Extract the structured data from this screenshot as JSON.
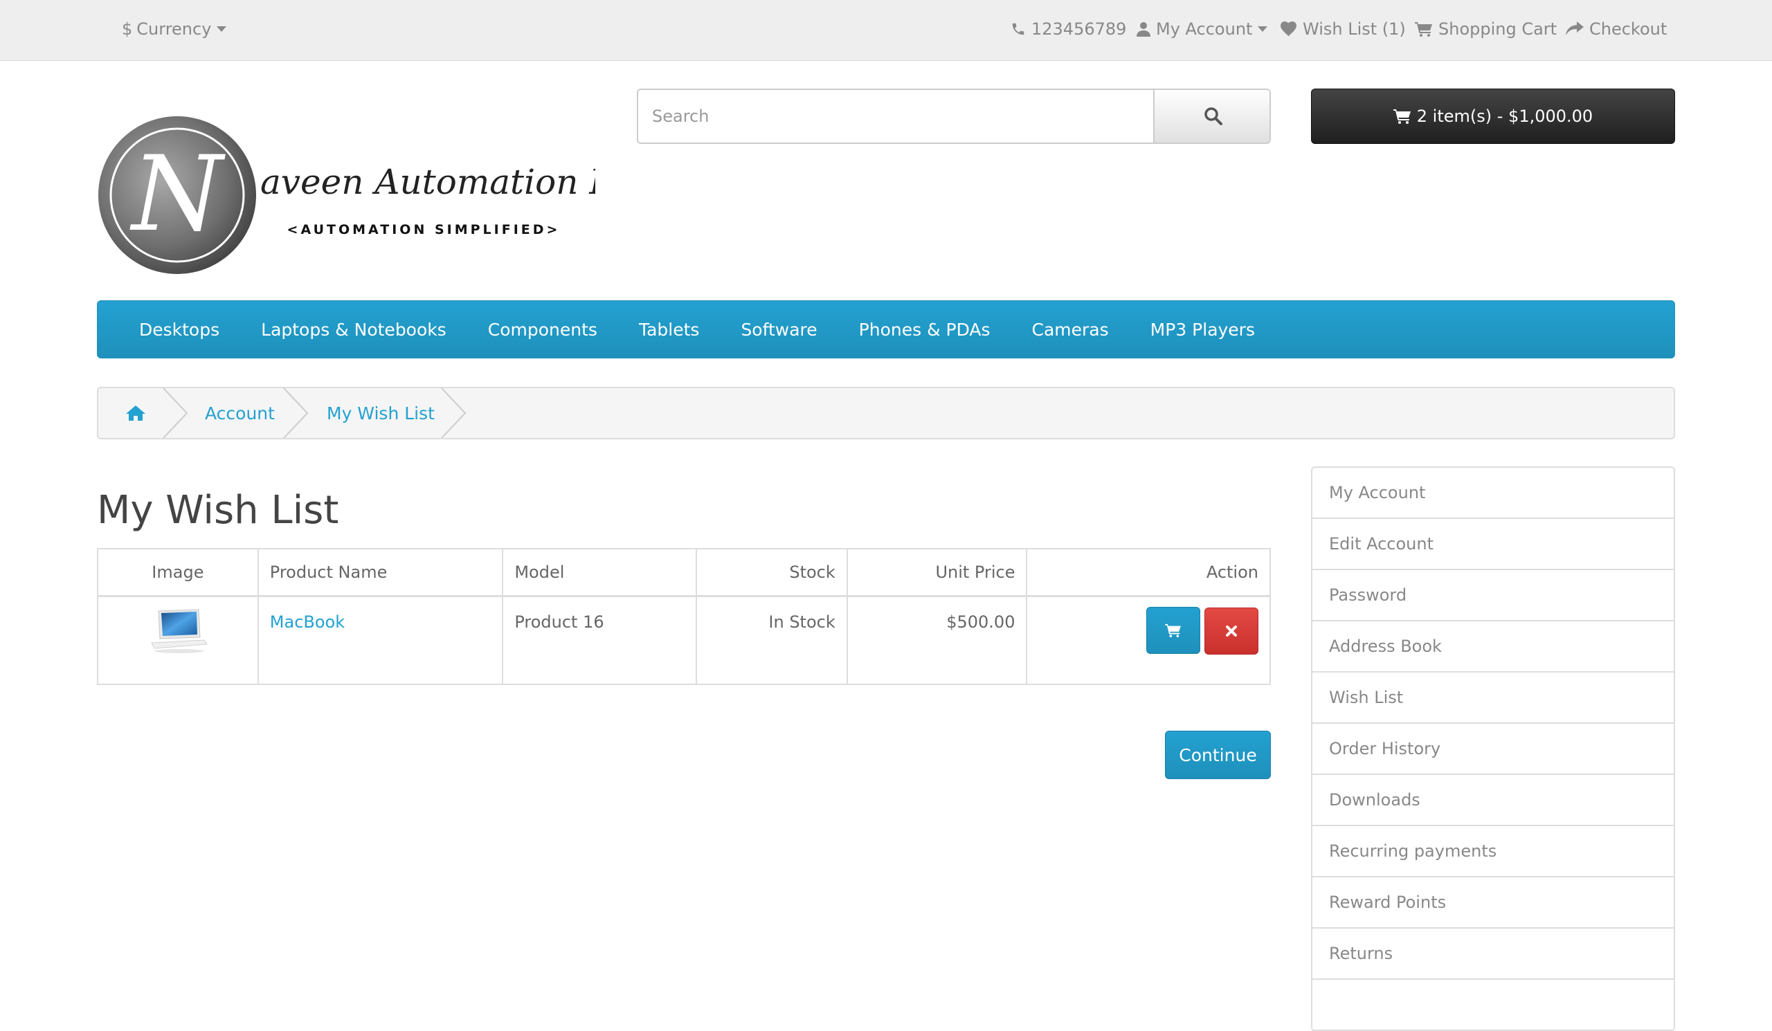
{
  "topbar": {
    "currency_symbol": "$",
    "currency_label": "Currency",
    "phone": "123456789",
    "my_account": "My Account",
    "wish_list": "Wish List (1)",
    "shopping_cart": "Shopping Cart",
    "checkout": "Checkout"
  },
  "header": {
    "logo_letter": "N",
    "logo_text": "aveen Automation Labs",
    "logo_tagline": "<AUTOMATION SIMPLIFIED>",
    "search_placeholder": "Search",
    "cart_summary": "2 item(s) - $1,000.00"
  },
  "menu": [
    "Desktops",
    "Laptops & Notebooks",
    "Components",
    "Tablets",
    "Software",
    "Phones & PDAs",
    "Cameras",
    "MP3 Players"
  ],
  "breadcrumb": [
    "Account",
    "My Wish List"
  ],
  "page_title": "My Wish List",
  "table": {
    "headers": [
      "Image",
      "Product Name",
      "Model",
      "Stock",
      "Unit Price",
      "Action"
    ],
    "rows": [
      {
        "name": "MacBook",
        "model": "Product 16",
        "stock": "In Stock",
        "price": "$500.00"
      }
    ]
  },
  "continue_label": "Continue",
  "account_links": [
    "My Account",
    "Edit Account",
    "Password",
    "Address Book",
    "Wish List",
    "Order History",
    "Downloads",
    "Recurring payments",
    "Reward Points",
    "Returns"
  ],
  "colors": {
    "accent": "#23a1d1",
    "danger": "#d9534f",
    "dark": "#303030"
  }
}
